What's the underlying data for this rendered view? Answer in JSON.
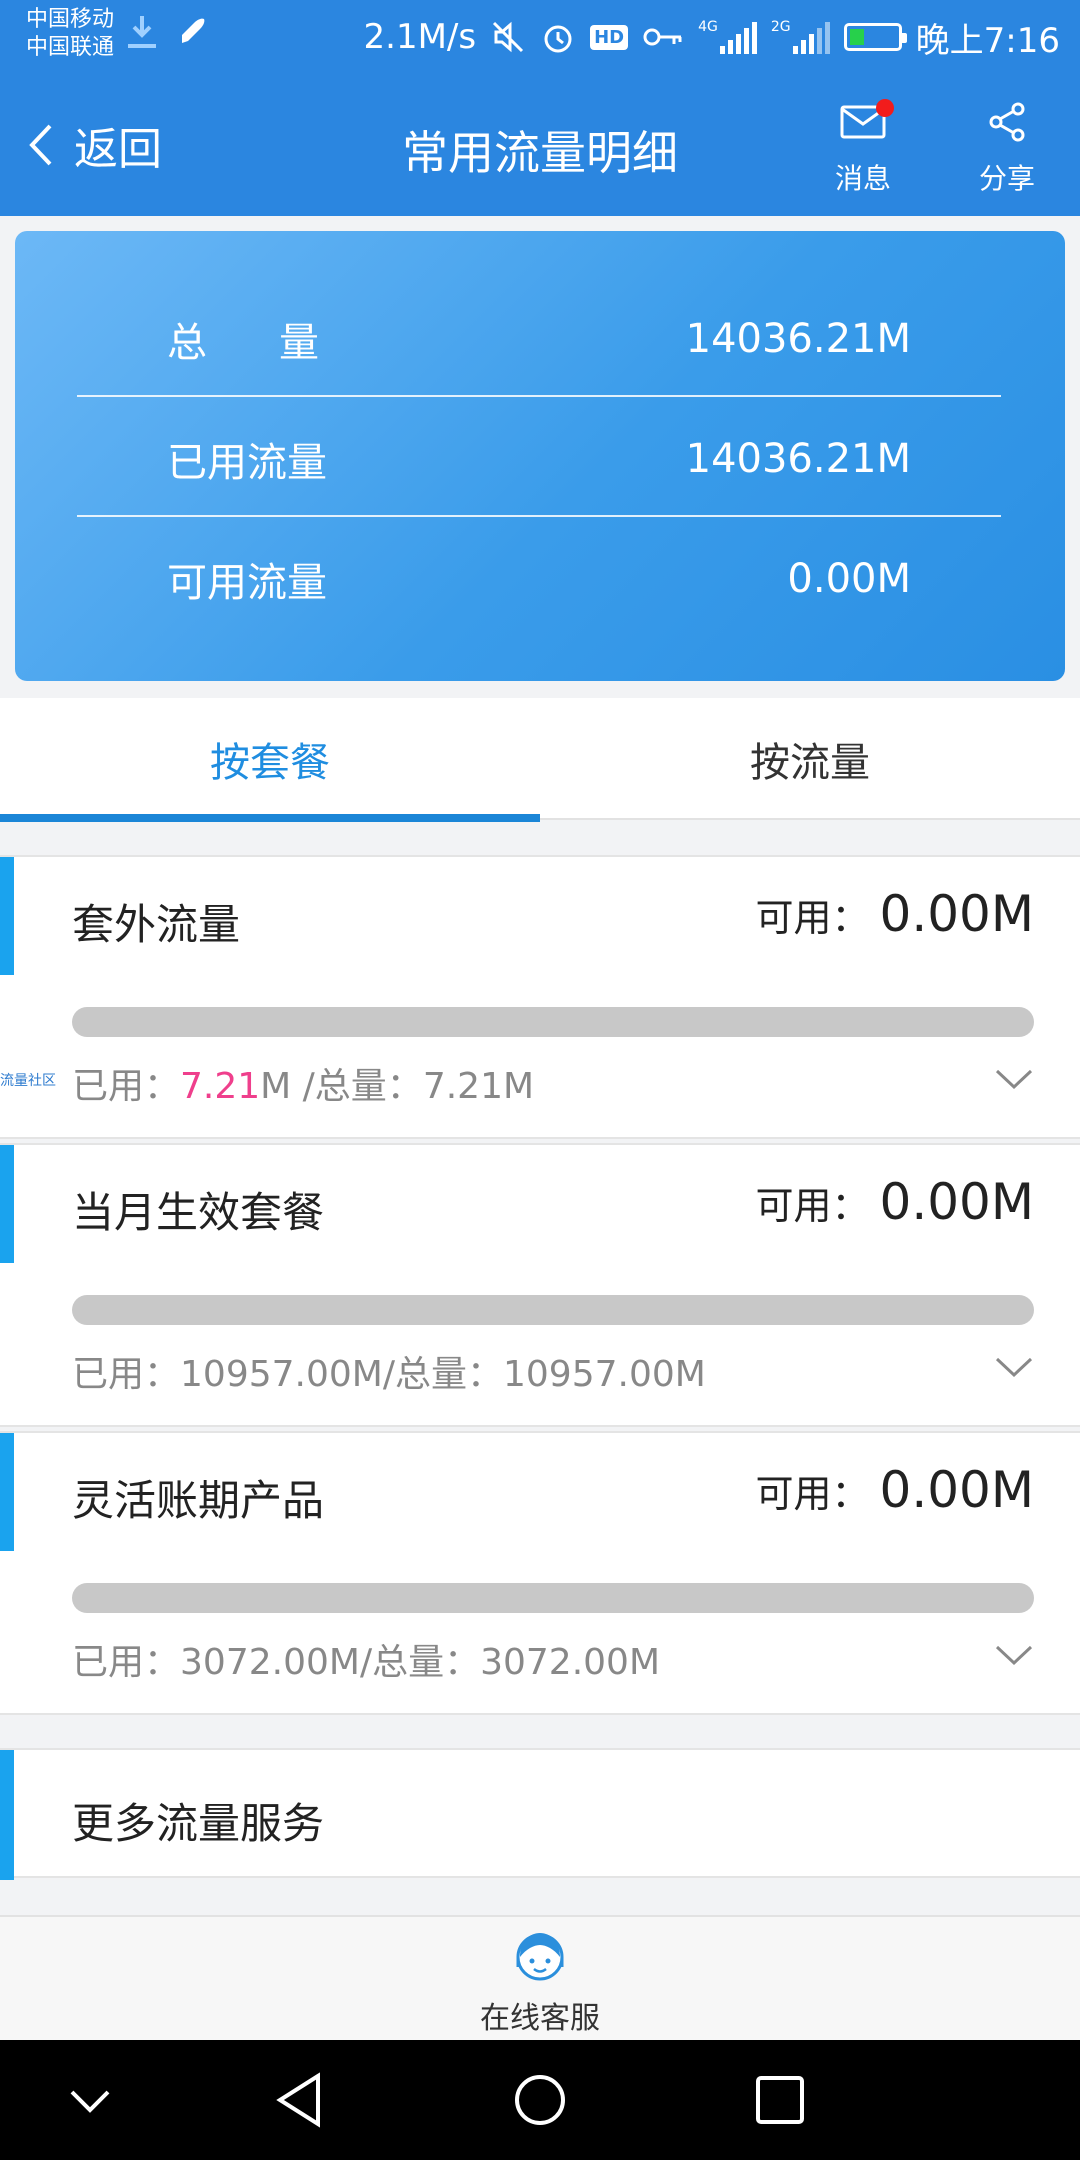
{
  "statusbar": {
    "carrier1": "中国移动",
    "carrier2": "中国联通",
    "speed": "2.1M/s",
    "hd": "HD",
    "net1": "4G",
    "net2": "2G",
    "time": "晚上7:16"
  },
  "nav": {
    "back_label": "返回",
    "title": "常用流量明细",
    "messages_label": "消息",
    "share_label": "分享"
  },
  "summary": {
    "rows": [
      {
        "label": "总量",
        "value": "14036.21M"
      },
      {
        "label": "已用流量",
        "value": "14036.21M"
      },
      {
        "label": "可用流量",
        "value": "0.00M"
      }
    ]
  },
  "tabs": [
    {
      "label": "按套餐",
      "active": true
    },
    {
      "label": "按流量",
      "active": false
    }
  ],
  "packages": [
    {
      "name": "套外流量",
      "avail_label": "可用：",
      "avail_value": "0.00M",
      "used_prefix": "已用：",
      "used_value": "7.21",
      "used_suffix": "M /总量：",
      "total_value": "7.21M",
      "used_fraction": 1.0
    },
    {
      "name": "当月生效套餐",
      "avail_label": "可用：",
      "avail_value": "0.00M",
      "used_prefix": "已用：",
      "used_value": "10957.00M",
      "used_suffix": "/总量：",
      "total_value": "10957.00M",
      "used_fraction": 1.0
    },
    {
      "name": "灵活账期产品",
      "avail_label": "可用：",
      "avail_value": "0.00M",
      "used_prefix": "已用：",
      "used_value": "3072.00M",
      "used_suffix": "/总量：",
      "total_value": "3072.00M",
      "used_fraction": 1.0
    }
  ],
  "watermark": "流量社区",
  "more": {
    "label": "更多流量服务"
  },
  "service": {
    "label": "在线客服"
  }
}
